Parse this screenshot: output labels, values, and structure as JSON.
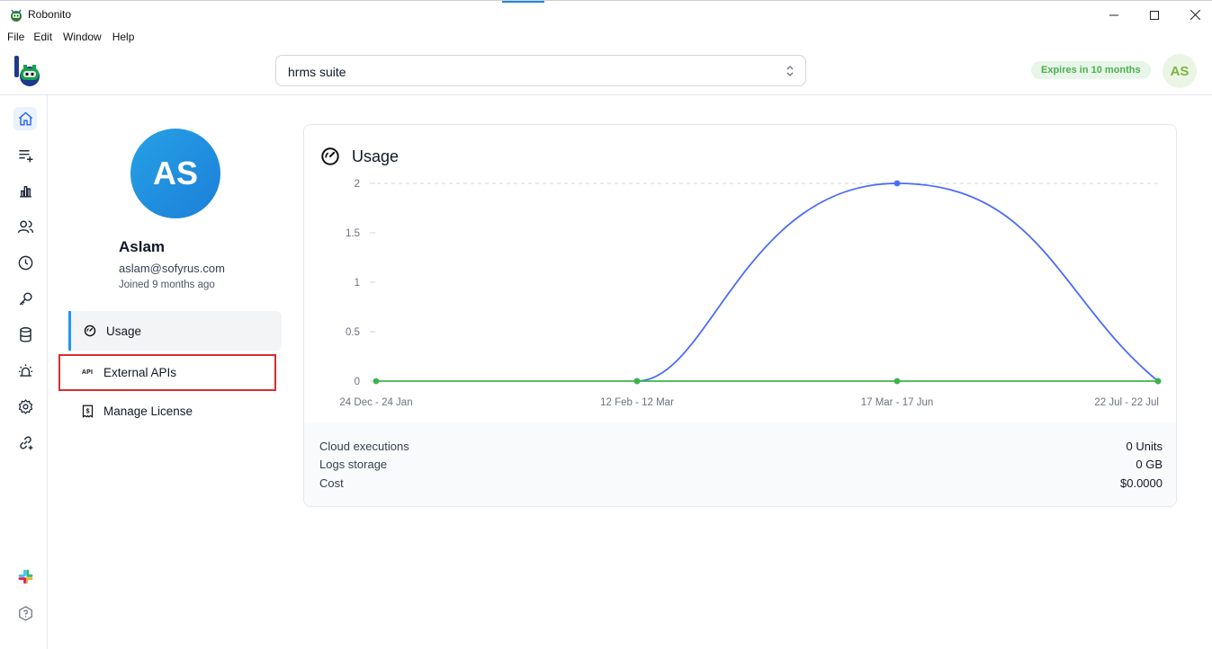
{
  "window": {
    "title": "Robonito",
    "controls": [
      "minimize",
      "maximize",
      "close"
    ]
  },
  "menu": [
    "File",
    "Edit",
    "Window",
    "Help"
  ],
  "header": {
    "suite_value": "hrms suite",
    "expires_badge": "Expires in 10 months",
    "avatar_initials": "AS"
  },
  "rail": {
    "items": [
      "home-icon",
      "list-add-icon",
      "bar-chart-icon",
      "users-icon",
      "clock-icon",
      "key-icon",
      "database-icon",
      "alarm-icon",
      "settings-icon",
      "link-add-icon"
    ],
    "bottom": [
      "slack-icon",
      "help-icon"
    ],
    "active": "home-icon",
    "accent": "#2563eb"
  },
  "profile": {
    "initials": "AS",
    "name": "Aslam",
    "email": "aslam@sofyrus.com",
    "joined": "Joined 9 months ago"
  },
  "nav": {
    "usage": "Usage",
    "api_glyph": "API",
    "external_apis": "External APIs",
    "manage_license": "Manage License"
  },
  "usage_card": {
    "title": "Usage",
    "summary": [
      {
        "label": "Cloud executions",
        "value": "0 Units"
      },
      {
        "label": "Logs storage",
        "value": "0 GB"
      },
      {
        "label": "Cost",
        "value": "$0.0000"
      }
    ]
  },
  "chart_data": {
    "type": "line",
    "title": "",
    "xlabel": "",
    "ylabel": "",
    "categories": [
      "24 Dec - 24 Jan",
      "12 Feb - 12 Mar",
      "17 Mar - 17 Jun",
      "22 Jul - 22 Jul"
    ],
    "ylim": [
      0,
      2
    ],
    "yticks": [
      "0",
      "0.5",
      "1",
      "1.5",
      "2"
    ],
    "grid": "dashed horizontal line at max",
    "series": [
      {
        "color": "#4a6cf7",
        "values": [
          null,
          0,
          2,
          0
        ]
      },
      {
        "color": "#3cb44b",
        "values": [
          0,
          0,
          0,
          0
        ]
      }
    ]
  }
}
